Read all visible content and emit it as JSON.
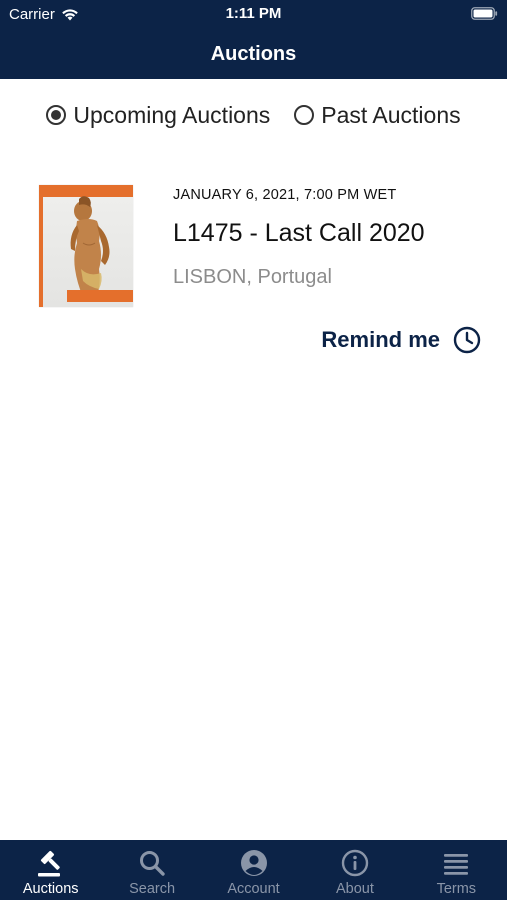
{
  "status_bar": {
    "carrier": "Carrier",
    "time": "1:11 PM"
  },
  "nav": {
    "title": "Auctions"
  },
  "filter": {
    "options": [
      {
        "label": "Upcoming Auctions",
        "selected": true
      },
      {
        "label": "Past Auctions",
        "selected": false
      }
    ]
  },
  "auctions": [
    {
      "date": "JANUARY 6, 2021, 7:00 PM WET",
      "title": "L1475 - Last Call 2020",
      "location": "LISBON, Portugal",
      "remind_label": "Remind me"
    }
  ],
  "tabs": [
    {
      "label": "Auctions",
      "icon": "gavel-icon",
      "active": true
    },
    {
      "label": "Search",
      "icon": "search-icon",
      "active": false
    },
    {
      "label": "Account",
      "icon": "account-icon",
      "active": false
    },
    {
      "label": "About",
      "icon": "info-icon",
      "active": false
    },
    {
      "label": "Terms",
      "icon": "menu-lines-icon",
      "active": false
    }
  ],
  "colors": {
    "navy": "#0c2347",
    "accent_orange": "#e46f2c",
    "muted_gray": "#8c8c8c"
  }
}
